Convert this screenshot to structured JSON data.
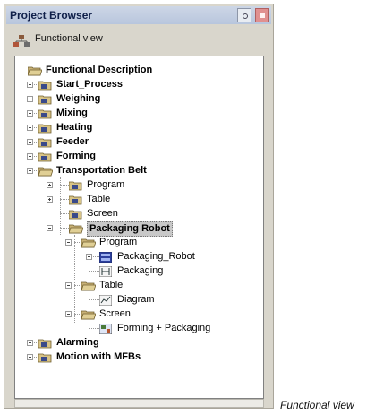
{
  "panel": {
    "title": "Project Browser"
  },
  "viewbar": {
    "label": "Functional view"
  },
  "tree": {
    "root": "Functional Description",
    "start_process": "Start_Process",
    "weighing": "Weighing",
    "mixing": "Mixing",
    "heating": "Heating",
    "feeder": "Feeder",
    "forming": "Forming",
    "transportation_belt": "Transportation Belt",
    "tb_program": "Program",
    "tb_table": "Table",
    "tb_screen": "Screen",
    "packaging_robot": "Packaging Robot",
    "pr_program": "Program",
    "pr_program_item1": "Packaging_Robot",
    "pr_program_item2": "Packaging",
    "pr_table": "Table",
    "pr_table_item1": "Diagram",
    "pr_screen": "Screen",
    "pr_screen_item1": "Forming + Packaging",
    "alarming": "Alarming",
    "motion_mfbs": "Motion with MFBs"
  },
  "caption": "Functional view"
}
